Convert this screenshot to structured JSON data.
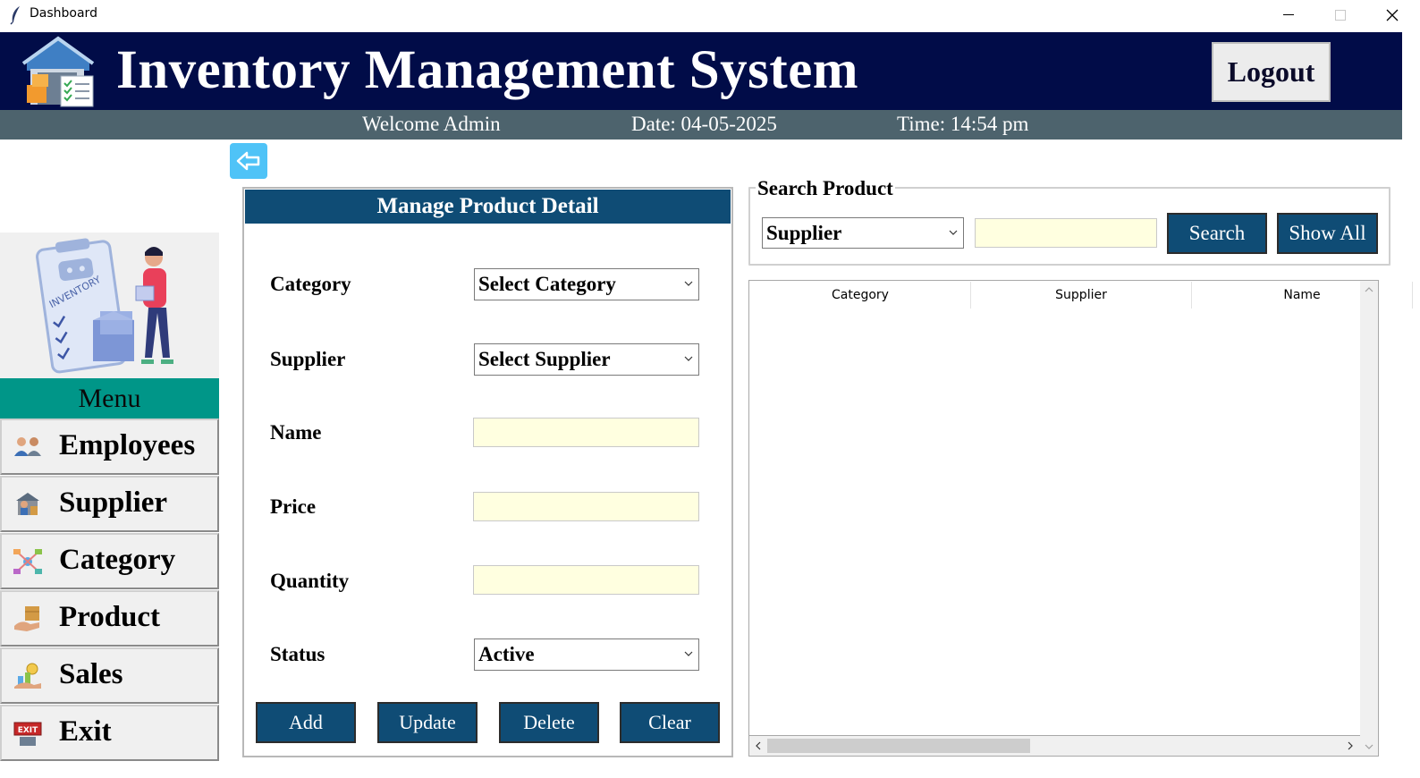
{
  "window": {
    "title": "Dashboard",
    "controls": [
      "minimize",
      "maximize",
      "close"
    ]
  },
  "header": {
    "title": "Inventory Management System",
    "logout_label": "Logout",
    "colors": {
      "header_bg": "#010c48",
      "subheader_bg": "#4d636d"
    }
  },
  "subheader": {
    "welcome": "Welcome Admin",
    "date": "Date: 04-05-2025",
    "time": "Time: 14:54 pm"
  },
  "menu": {
    "title": "Menu",
    "illustration_text": "INVENTORY",
    "items": [
      {
        "label": "Employees",
        "icon": "employees-icon"
      },
      {
        "label": "Supplier",
        "icon": "supplier-icon"
      },
      {
        "label": "Category",
        "icon": "category-icon"
      },
      {
        "label": "Product",
        "icon": "product-icon"
      },
      {
        "label": "Sales",
        "icon": "sales-icon"
      },
      {
        "label": "Exit",
        "icon": "exit-icon"
      }
    ],
    "exit_sign_text": "EXIT",
    "colors": {
      "menu_head_bg": "#009688"
    }
  },
  "form": {
    "title": "Manage Product Detail",
    "fields": {
      "category": {
        "label": "Category",
        "value": "Select Category"
      },
      "supplier": {
        "label": "Supplier",
        "value": "Select Supplier"
      },
      "name": {
        "label": "Name",
        "value": ""
      },
      "price": {
        "label": "Price",
        "value": ""
      },
      "quantity": {
        "label": "Quantity",
        "value": ""
      },
      "status": {
        "label": "Status",
        "value": "Active"
      }
    },
    "buttons": {
      "add": "Add",
      "update": "Update",
      "delete": "Delete",
      "clear": "Clear"
    },
    "colors": {
      "accent": "#0f4c75",
      "input_bg": "#ffffe0"
    }
  },
  "search": {
    "legend": "Search Product",
    "by_value": "Supplier",
    "query": "",
    "search_label": "Search",
    "show_all_label": "Show All"
  },
  "table": {
    "columns": [
      "Category",
      "Supplier",
      "Name"
    ],
    "rows": []
  }
}
